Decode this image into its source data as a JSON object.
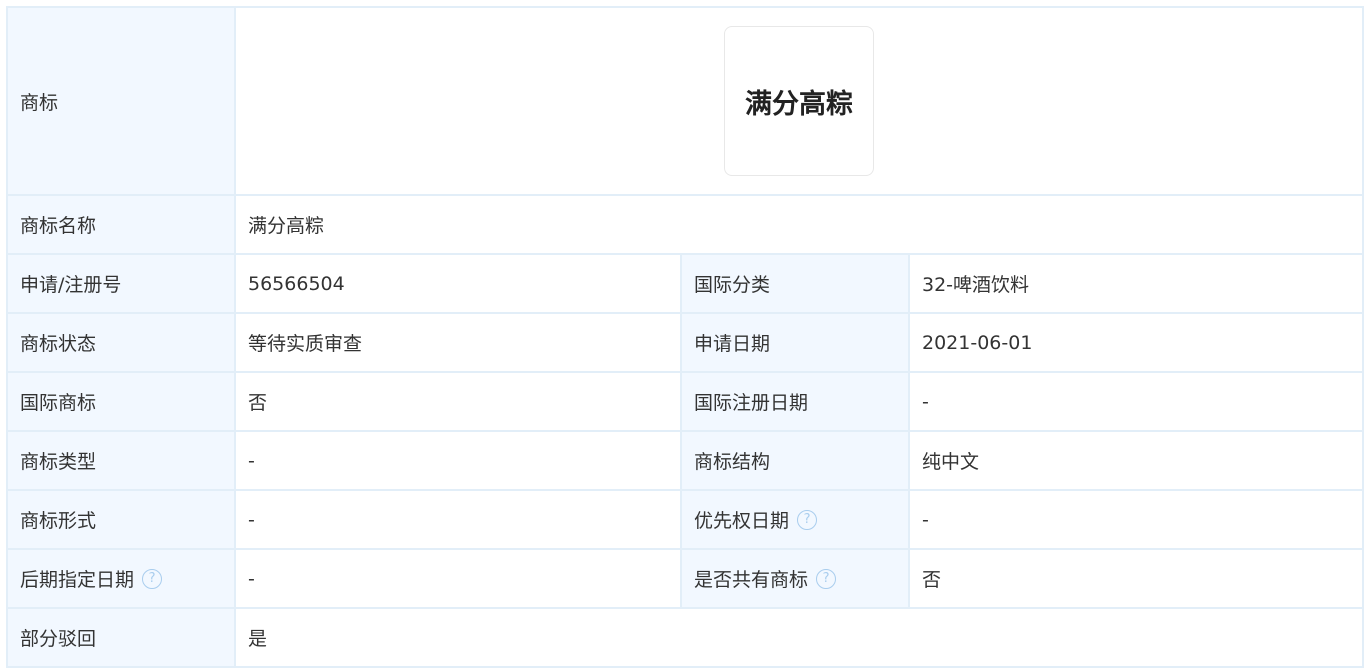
{
  "trademark": {
    "logo_label": "商标",
    "logo_text": "满分高粽",
    "rows": {
      "name": {
        "label": "商标名称",
        "value": "满分高粽"
      },
      "reg_no": {
        "label": "申请/注册号",
        "value": "56566504"
      },
      "intl_class": {
        "label": "国际分类",
        "value": "32-啤酒饮料"
      },
      "status": {
        "label": "商标状态",
        "value": "等待实质审查"
      },
      "apply_date": {
        "label": "申请日期",
        "value": "2021-06-01"
      },
      "intl_mark": {
        "label": "国际商标",
        "value": "否"
      },
      "intl_reg_date": {
        "label": "国际注册日期",
        "value": "-"
      },
      "mark_type": {
        "label": "商标类型",
        "value": "-"
      },
      "mark_structure": {
        "label": "商标结构",
        "value": "纯中文"
      },
      "mark_form": {
        "label": "商标形式",
        "value": "-"
      },
      "priority_date": {
        "label": "优先权日期",
        "value": "-"
      },
      "later_designation_date": {
        "label": "后期指定日期",
        "value": "-"
      },
      "shared_mark": {
        "label": "是否共有商标",
        "value": "否"
      },
      "partial_reject": {
        "label": "部分驳回",
        "value": "是"
      }
    },
    "help_glyph": "?"
  }
}
